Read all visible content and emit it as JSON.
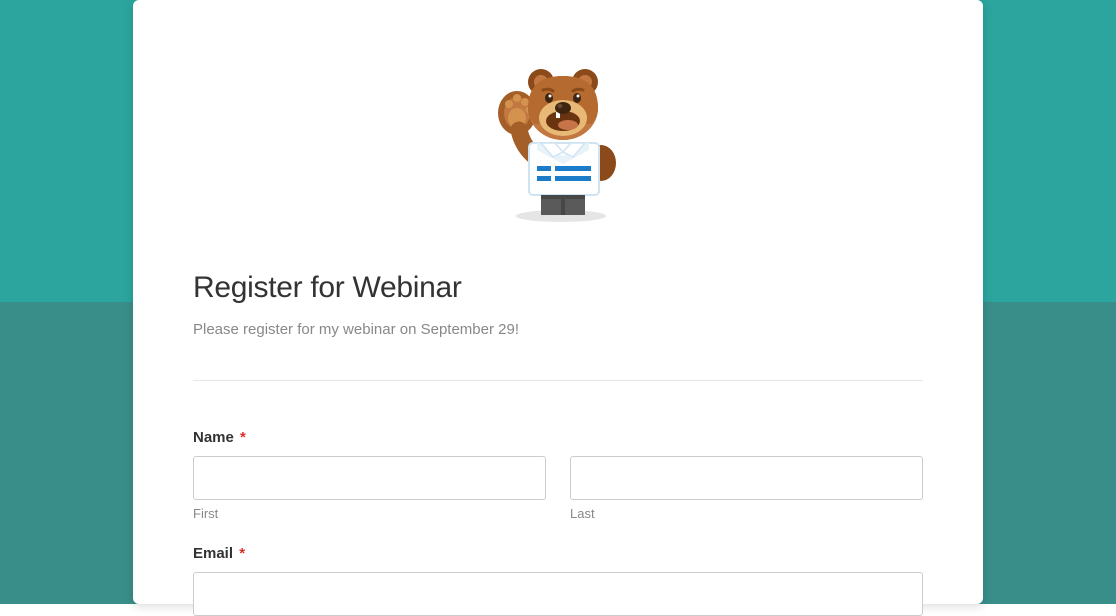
{
  "form": {
    "title": "Register for Webinar",
    "description": "Please register for my webinar on September 29!",
    "required_mark": "*",
    "fields": {
      "name": {
        "label": "Name",
        "required": true,
        "first_sublabel": "First",
        "last_sublabel": "Last"
      },
      "email": {
        "label": "Email",
        "required": true
      }
    }
  },
  "mascot": {
    "name": "bear-mascot-icon"
  }
}
